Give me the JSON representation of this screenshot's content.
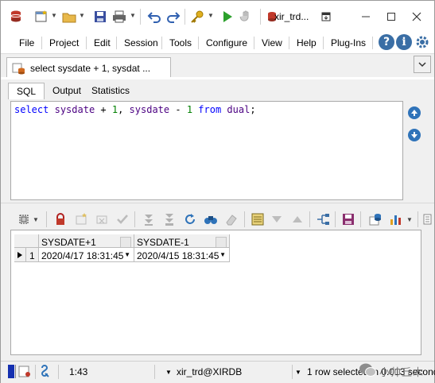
{
  "window": {
    "title": "xir_trd..."
  },
  "menu": {
    "items": [
      "File",
      "Project",
      "Edit",
      "Session",
      "Tools",
      "Configure",
      "View",
      "Help",
      "Plug-Ins"
    ]
  },
  "document_tab": {
    "label": "select sysdate + 1, sysdat ..."
  },
  "sql_tabs": {
    "items": [
      "SQL",
      "Output",
      "Statistics"
    ],
    "active": "SQL"
  },
  "editor": {
    "sql_text": "select sysdate + 1, sysdate - 1 from dual;",
    "tokens": [
      {
        "t": "select",
        "k": "kw"
      },
      {
        "t": " ",
        "k": "op"
      },
      {
        "t": "sysdate",
        "k": "ident"
      },
      {
        "t": " + ",
        "k": "op"
      },
      {
        "t": "1",
        "k": "num"
      },
      {
        "t": ", ",
        "k": "op"
      },
      {
        "t": "sysdate",
        "k": "ident"
      },
      {
        "t": " - ",
        "k": "op"
      },
      {
        "t": "1",
        "k": "num"
      },
      {
        "t": " ",
        "k": "op"
      },
      {
        "t": "from",
        "k": "kw"
      },
      {
        "t": " ",
        "k": "op"
      },
      {
        "t": "dual",
        "k": "ident"
      },
      {
        "t": ";",
        "k": "op"
      }
    ]
  },
  "grid": {
    "columns": [
      "SYSDATE+1",
      "SYSDATE-1"
    ],
    "rows": [
      {
        "num": "1",
        "cells": [
          "2020/4/17 18:31:45",
          "2020/4/15 18:31:45"
        ]
      }
    ]
  },
  "status": {
    "position": "1:43",
    "connection": "xir_trd@XIRDB",
    "message": "1 row selected in 0.013 seconds"
  },
  "watermark": {
    "text": "小帅丘木"
  },
  "colors": {
    "keyword": "#0000ff",
    "identifier": "#4b0082",
    "number": "#008000",
    "accent_blue": "#2f73b9"
  }
}
